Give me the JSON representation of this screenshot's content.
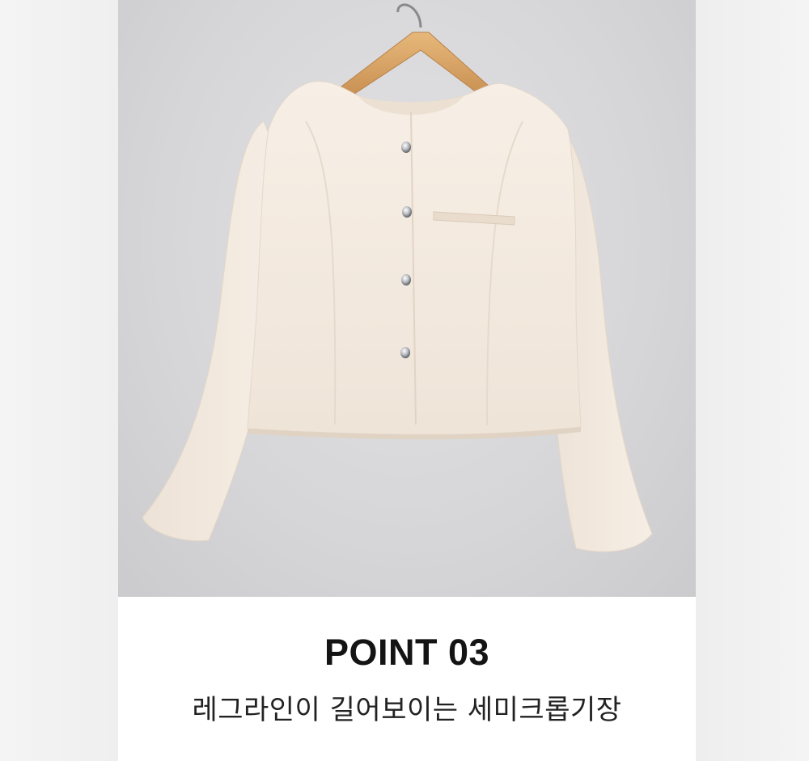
{
  "image": {
    "subject": "cream jacket on wooden hanger",
    "background_color": "#d9d9db",
    "jacket_color": "#f3e9df",
    "hanger_color": "#d9a86a"
  },
  "caption": {
    "title": "POINT 03",
    "description": "레그라인이 길어보이는 세미크롭기장"
  }
}
